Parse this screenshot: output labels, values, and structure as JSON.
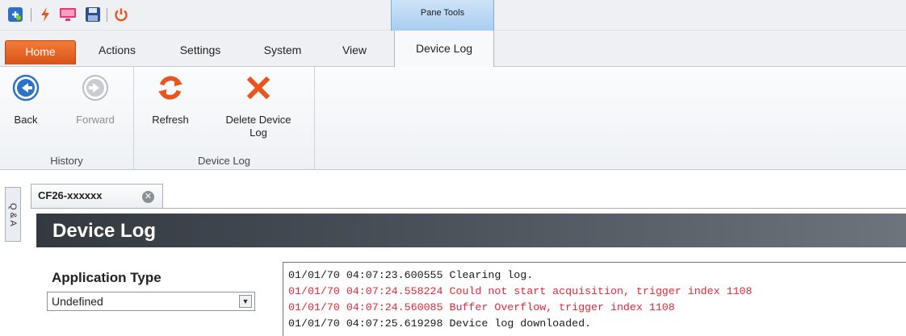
{
  "quick_access": {
    "icons": [
      "app-logo-icon",
      "lightning-icon",
      "monitor-icon",
      "save-icon",
      "power-icon"
    ]
  },
  "contextual_header": {
    "label": "Pane Tools"
  },
  "tabs": [
    {
      "label": "Home",
      "active": false,
      "accent": "#e8642b"
    },
    {
      "label": "Actions"
    },
    {
      "label": "Settings"
    },
    {
      "label": "System"
    },
    {
      "label": "View"
    },
    {
      "label": "Device Log",
      "active": true
    }
  ],
  "ribbon": {
    "groups": [
      {
        "label": "History",
        "buttons": [
          {
            "label": "Back",
            "icon": "arrow-left-circle-icon",
            "enabled": true
          },
          {
            "label": "Forward",
            "icon": "arrow-right-circle-icon",
            "enabled": false
          }
        ]
      },
      {
        "label": "Device Log",
        "buttons": [
          {
            "label": "Refresh",
            "icon": "refresh-icon",
            "enabled": true
          },
          {
            "label_line1": "Delete Device",
            "label_line2": "Log",
            "icon": "delete-x-icon",
            "enabled": true
          }
        ]
      }
    ]
  },
  "side_panel": {
    "label": "Q & A"
  },
  "document_tab": {
    "label": "CF26-xxxxxx"
  },
  "page_title": "Device Log",
  "application_type": {
    "label": "Application Type",
    "value": "Undefined"
  },
  "log": {
    "lines": [
      {
        "text": "01/01/70 04:07:23.600555 Clearing log.",
        "level": "info"
      },
      {
        "text": "01/01/70 04:07:24.558224 Could not start acquisition, trigger index 1108",
        "level": "error"
      },
      {
        "text": "01/01/70 04:07:24.560085 Buffer Overflow, trigger index 1108",
        "level": "error"
      },
      {
        "text": "01/01/70 04:07:25.619298 Device log downloaded.",
        "level": "info"
      }
    ]
  },
  "colors": {
    "home_tab": "#e8642b",
    "error_text": "#e32636",
    "banner": "#3e444a",
    "refresh_icon": "#e8561e",
    "delete_icon": "#e8561e",
    "nav_icon": "#2a73c9"
  }
}
